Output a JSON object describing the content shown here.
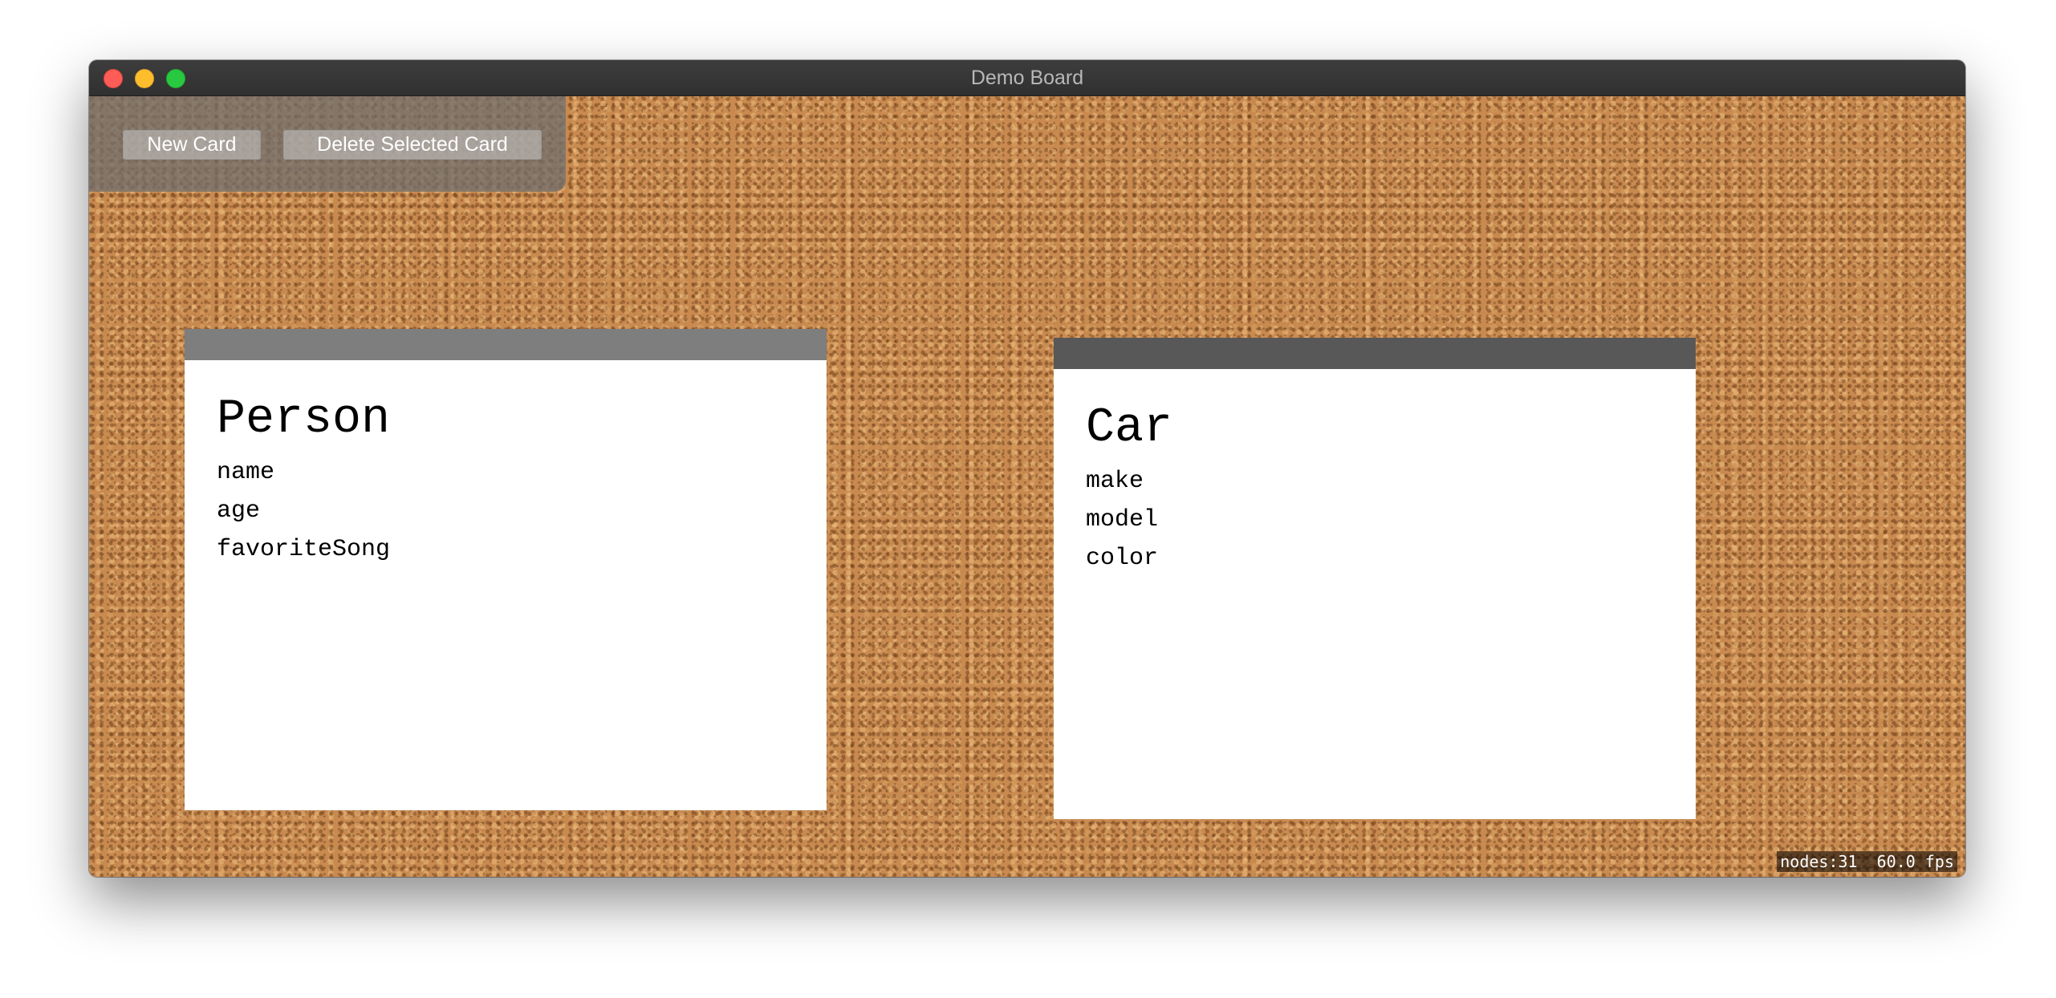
{
  "window": {
    "title": "Demo Board"
  },
  "toolbar": {
    "new_card_label": "New Card",
    "delete_card_label": "Delete Selected Card"
  },
  "cards": [
    {
      "title": "Person",
      "header_color": "#7e7e7e",
      "fields": [
        "name",
        "age",
        "favoriteSong"
      ]
    },
    {
      "title": "Car",
      "header_color": "#585858",
      "fields": [
        "make",
        "model",
        "color"
      ]
    }
  ],
  "stats": {
    "text": "nodes:31  60.0 fps"
  },
  "colors": {
    "titlebar": "#353535",
    "cork": "#c98a50",
    "close": "#fd5c57",
    "minimize": "#fdbd2d",
    "maximize": "#28c940"
  }
}
